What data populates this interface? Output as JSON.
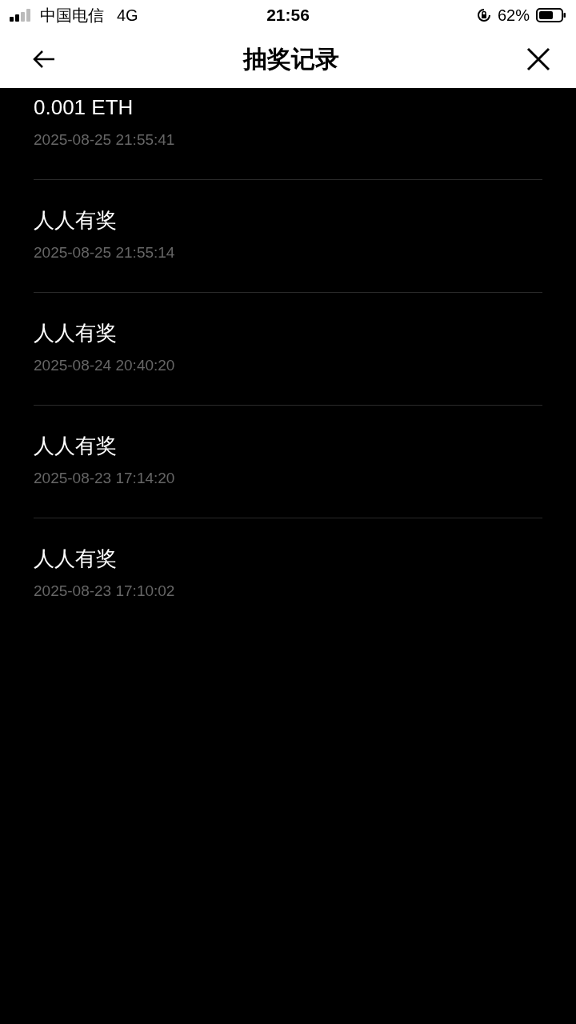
{
  "status_bar": {
    "carrier": "中国电信",
    "network": "4G",
    "time": "21:56",
    "battery": "62%"
  },
  "nav": {
    "title": "抽奖记录"
  },
  "records": [
    {
      "prize": "0.001 ETH",
      "time": "2025-08-25 21:55:41"
    },
    {
      "prize": "人人有奖",
      "time": "2025-08-25 21:55:14"
    },
    {
      "prize": "人人有奖",
      "time": "2025-08-24 20:40:20"
    },
    {
      "prize": "人人有奖",
      "time": "2025-08-23 17:14:20"
    },
    {
      "prize": "人人有奖",
      "time": "2025-08-23 17:10:02"
    }
  ]
}
